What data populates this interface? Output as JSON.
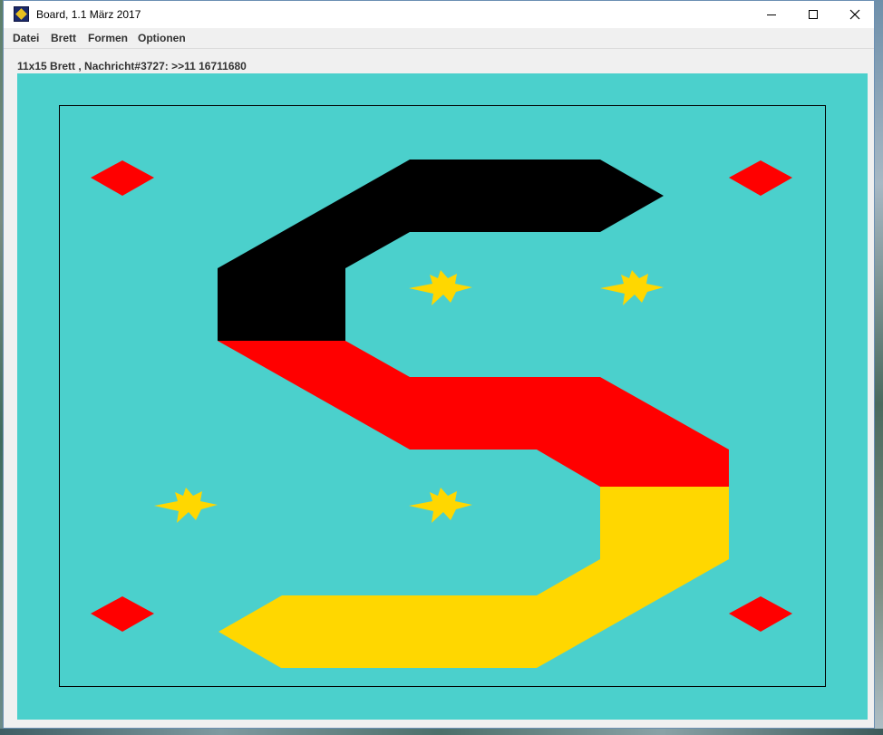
{
  "window": {
    "title": "Board, 1.1 März 2017",
    "icon": "board-app-icon",
    "controls": [
      "minimize-icon",
      "maximize-icon",
      "close-icon"
    ]
  },
  "menu": {
    "items": [
      {
        "label": "Datei"
      },
      {
        "label": "Brett"
      },
      {
        "label": "Formen"
      },
      {
        "label": "Optionen"
      }
    ]
  },
  "status": {
    "text": "11x15 Brett , Nachricht#3727: >>11 16711680"
  },
  "board": {
    "background": "#4bd0cc",
    "colors": {
      "black": "#000000",
      "red": "#ff0000",
      "gold": "#ffd700",
      "frame": "#000000"
    },
    "shapes": {
      "diamonds": 4,
      "stars": 4,
      "snake_segments": [
        "black",
        "red",
        "gold"
      ]
    }
  }
}
